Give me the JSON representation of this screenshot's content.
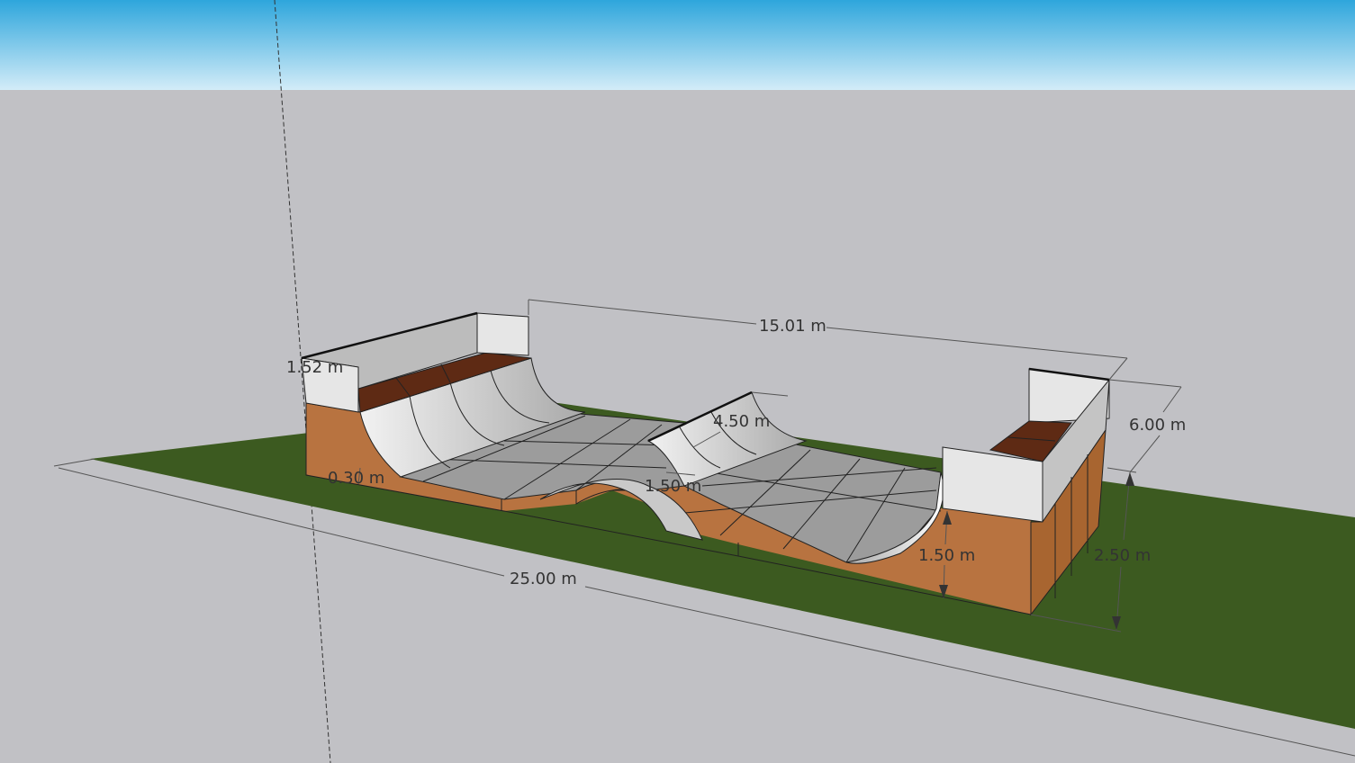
{
  "colors": {
    "sky_top": "#2ea6dc",
    "sky_bottom": "#d3ecf8",
    "ground": "#c1c1c5",
    "grass": "#3c5a20",
    "wood": "#b87340",
    "deck": "#5e2a14",
    "coping": "#e6e6e6",
    "ramp_light": "#e0e0e0",
    "floor": "#9c9c9c"
  },
  "dimensions": {
    "total_length": "25.00 m",
    "inner_length": "15.01 m",
    "width": "6.00 m",
    "overall_height": "2.50 m",
    "ramp_height": "1.50 m",
    "hump_height": "1.50 m",
    "spine_width": "4.50 m",
    "coping_height": "1.52 m",
    "lip_offset": "0.30 m"
  }
}
